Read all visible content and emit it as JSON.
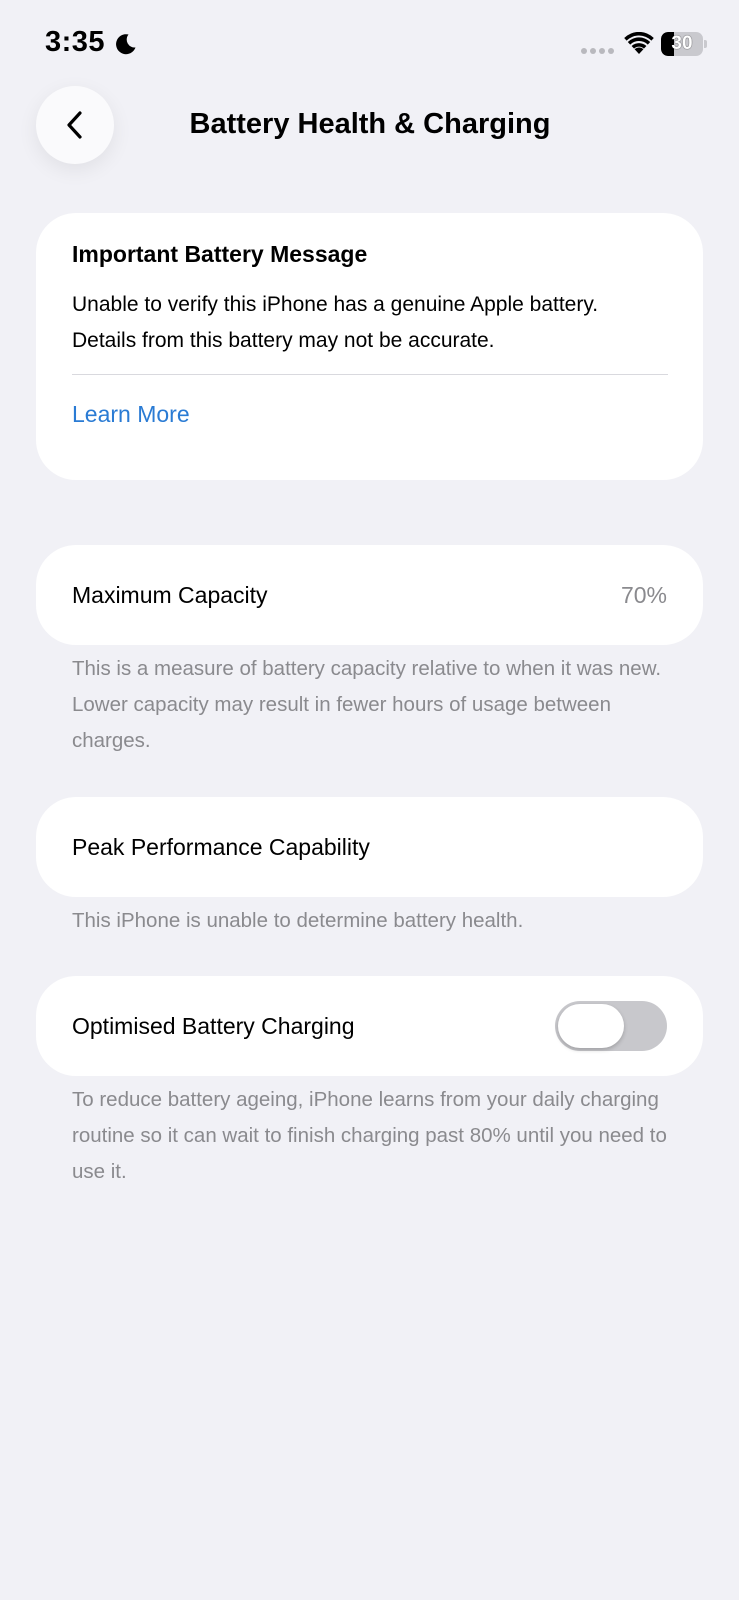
{
  "status_bar": {
    "time": "3:35",
    "battery_level": "30",
    "battery_fraction": 0.3
  },
  "nav": {
    "title": "Battery Health & Charging"
  },
  "message_card": {
    "title": "Important Battery Message",
    "body_line1": "Unable to verify this iPhone has a genuine Apple battery.",
    "body_line2": "Details from this battery may not be accurate.",
    "link": "Learn More"
  },
  "maximum_capacity": {
    "label": "Maximum Capacity",
    "value": "70%",
    "footnote": "This is a measure of battery capacity relative to when it was new. Lower capacity may result in fewer hours of usage between charges."
  },
  "peak_performance": {
    "label": "Peak Performance Capability",
    "footnote": "This iPhone is unable to determine battery health."
  },
  "optimised_charging": {
    "label": "Optimised Battery Charging",
    "enabled": false,
    "footnote": "To reduce battery ageing, iPhone learns from your daily charging routine so it can wait to finish charging past 80% until you need to use it."
  },
  "colors": {
    "background": "#f1f1f6",
    "link": "#2a7bd4",
    "secondary_text": "#8a8a8e",
    "toggle_off": "#c8c8cc"
  }
}
